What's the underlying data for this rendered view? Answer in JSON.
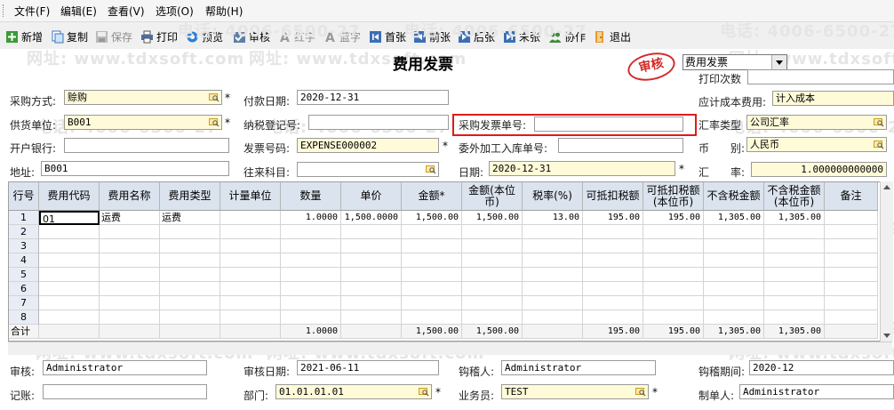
{
  "menu": [
    "文件(F)",
    "编辑(E)",
    "查看(V)",
    "选项(O)",
    "帮助(H)"
  ],
  "toolbar": {
    "new": "新增",
    "copy": "复制",
    "save": "保存",
    "print": "打印",
    "preview": "预览",
    "audit": "审核",
    "red": "红字",
    "blue": "蓝字",
    "first": "首张",
    "prev": "前张",
    "next": "后张",
    "last": "末张",
    "collab": "协作",
    "exit": "退出"
  },
  "header": {
    "title": "费用发票",
    "stamp": "审核",
    "invoice_type": "费用发票",
    "print_count_label": "打印次数"
  },
  "watermark": {
    "phone": "电话: 4006-6500-27",
    "site": "网址: www.tdxsoft.com"
  },
  "form": {
    "purchase_method": {
      "label": "采购方式:",
      "value": "赊购"
    },
    "pay_date": {
      "label": "付款日期:",
      "value": "2020-12-31"
    },
    "cost_account": {
      "label": "应计成本费用:",
      "value": "计入成本"
    },
    "supplier": {
      "label": "供货单位:",
      "value": "B001"
    },
    "tax_reg": {
      "label": "纳税登记号:",
      "value": ""
    },
    "purchase_invoice_no": {
      "label": "采购发票单号:",
      "value": ""
    },
    "rate_type": {
      "label": "汇率类型",
      "value": "公司汇率"
    },
    "bank": {
      "label": "开户银行:",
      "value": ""
    },
    "invoice_no": {
      "label": "发票号码:",
      "value": "EXPENSE000002"
    },
    "outsource_no": {
      "label": "委外加工入库单号:",
      "value": ""
    },
    "currency": {
      "label": "币　　别:",
      "value": "人民币"
    },
    "address": {
      "label": "地址:",
      "value": "B001"
    },
    "account": {
      "label": "往来科目:",
      "value": ""
    },
    "date": {
      "label": "日期:",
      "value": "2020-12-31"
    },
    "rate": {
      "label": "汇　　率:",
      "value": "1.000000000000"
    }
  },
  "grid": {
    "columns": [
      "行号",
      "费用代码",
      "费用名称",
      "费用类型",
      "计量单位",
      "数量",
      "单价",
      "金额*",
      "金额(本位币)",
      "税率(%)",
      "可抵扣税额",
      "可抵扣税额(本位币)",
      "不含税金额",
      "不含税金额(本位币)",
      "备注"
    ],
    "rows": [
      [
        "1",
        "01",
        "运费",
        "运费",
        "",
        "1.0000",
        "1,500.0000",
        "1,500.00",
        "1,500.00",
        "13.00",
        "195.00",
        "195.00",
        "1,305.00",
        "1,305.00",
        ""
      ],
      [
        "2"
      ],
      [
        "3"
      ],
      [
        "4"
      ],
      [
        "5"
      ],
      [
        "6"
      ],
      [
        "7"
      ],
      [
        "8"
      ]
    ],
    "total": [
      "合计",
      "",
      "",
      "",
      "",
      "1.0000",
      "",
      "1,500.00",
      "1,500.00",
      "",
      "195.00",
      "195.00",
      "1,305.00",
      "1,305.00",
      ""
    ]
  },
  "footer": {
    "auditor": {
      "label": "审核:",
      "value": "Administrator"
    },
    "audit_date": {
      "label": "审核日期:",
      "value": "2021-06-11"
    },
    "checker": {
      "label": "钩稽人:",
      "value": "Administrator"
    },
    "check_period": {
      "label": "钩稽期间:",
      "value": "2020-12"
    },
    "bookkeeper": {
      "label": "记账:",
      "value": ""
    },
    "department": {
      "label": "部门:",
      "value": "01.01.01.01"
    },
    "salesman": {
      "label": "业务员:",
      "value": "TEST"
    },
    "maker": {
      "label": "制单人:",
      "value": "Administrator"
    }
  }
}
